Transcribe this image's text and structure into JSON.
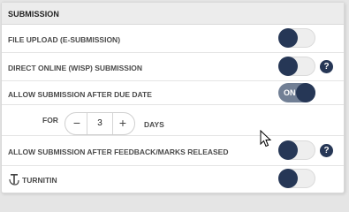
{
  "section": {
    "title": "SUBMISSION"
  },
  "settings": [
    {
      "label": "FILE UPLOAD (E-SUBMISSION)",
      "state": "off",
      "help_icon": false
    },
    {
      "label": "DIRECT ONLINE (WISP) SUBMISSION",
      "state": "off",
      "help_icon": true
    },
    {
      "label": "ALLOW SUBMISSION AFTER DUE DATE",
      "state": "on",
      "on_text": "ON",
      "help_icon": false
    },
    {
      "label": "ALLOW SUBMISSION AFTER FEEDBACK/MARKS RELEASED",
      "state": "off",
      "help_icon": true
    },
    {
      "label": "TURNITIN",
      "state": "off",
      "help_icon": false,
      "icon": "turnitin-logo-icon"
    }
  ],
  "late_days": {
    "prefix": "FOR",
    "value": "3",
    "unit": "DAYS",
    "decrement_symbol": "−",
    "increment_symbol": "+"
  },
  "help": {
    "symbol": "?"
  },
  "colors": {
    "toggle_knob": "#263756",
    "toggle_on_track": "#717f95",
    "header_bg": "#ececec"
  }
}
